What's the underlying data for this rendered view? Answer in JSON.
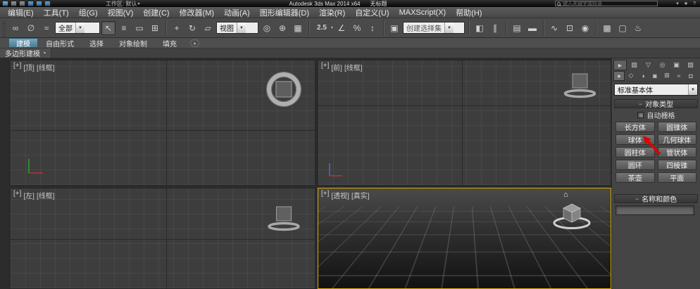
{
  "colors": {
    "active_viewport_border": "#d8a900",
    "annotation_arrow": "#e00000",
    "active_ribbon_tab": "#49788f",
    "panel_background": "#454545",
    "viewport_background": "#3d3d3d"
  },
  "title_bar": {
    "workspace": "工作区: 默认",
    "app_title": "Autodesk 3ds Max 2014 x64",
    "doc_title": "无标题",
    "search_placeholder": "键入关键字或短语"
  },
  "menu": {
    "items": [
      "编辑(E)",
      "工具(T)",
      "组(G)",
      "视图(V)",
      "创建(C)",
      "修改器(M)",
      "动画(A)",
      "图形编辑器(D)",
      "渲染(R)",
      "自定义(U)",
      "MAXScript(X)",
      "帮助(H)"
    ]
  },
  "toolbar": {
    "selection_filter": "全部",
    "coordinate_system": "视图",
    "snap_value": "2.5",
    "selection_set_placeholder": "创建选择集"
  },
  "ribbon": {
    "tabs": [
      "建模",
      "自由形式",
      "选择",
      "对象绘制",
      "填充"
    ],
    "subtab": "多边形建模"
  },
  "viewports": [
    {
      "plus": "[+]",
      "name": "[顶]",
      "shading": "[线框]"
    },
    {
      "plus": "[+]",
      "name": "[前]",
      "shading": "[线框]"
    },
    {
      "plus": "[+]",
      "name": "[左]",
      "shading": "[线框]"
    },
    {
      "plus": "[+]",
      "name": "[透视]",
      "shading": "[真实]"
    }
  ],
  "command_panel": {
    "primitive_category": "标准基本体",
    "object_type_rollout": "对象类型",
    "autogrid": "自动栅格",
    "buttons": [
      "长方体",
      "圆锥体",
      "球体",
      "几何球体",
      "圆柱体",
      "管状体",
      "圆环",
      "四棱锥",
      "茶壶",
      "平面"
    ],
    "name_color_rollout": "名称和颜色"
  },
  "icons": {
    "link": "∞",
    "unlink": "∅",
    "bind": "≈",
    "select": "↖",
    "select_by_name": "≡",
    "marquee": "▭",
    "window_crossing": "⊞",
    "move": "+",
    "rotate": "↻",
    "scale": "▱",
    "pivot": "◎",
    "manipulate": "⊕",
    "keyboard_override": "▦",
    "angle_snap": "∠",
    "percent_snap": "%",
    "spinner_snap": "↕",
    "edit_sets": "▣",
    "mirror": "◧",
    "align": "∥",
    "layers": "▤",
    "ribbon_toggle": "▬",
    "curve_editor": "∿",
    "schematic": "⊡",
    "material_editor": "◉",
    "render_setup": "▩",
    "render_frame": "▢",
    "render": "♨",
    "dropdown_arrow": "▼",
    "collapse": "▴",
    "subtab_arrow": "▾",
    "home": "⌂",
    "minus": "−",
    "cp_tabs": [
      "►",
      "▧",
      "▽",
      "◎",
      "▣",
      "▨"
    ],
    "cp_cats": [
      "●",
      "◇",
      "◑",
      "◙",
      "⊞",
      "≈",
      "◘"
    ]
  }
}
